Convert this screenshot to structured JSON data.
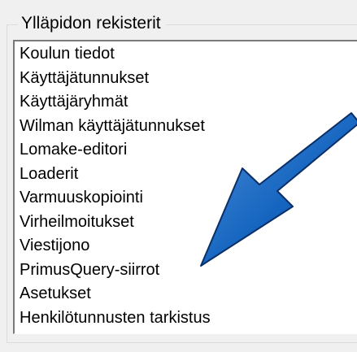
{
  "groupbox": {
    "title": "Ylläpidon rekisterit"
  },
  "list": {
    "items": [
      "Koulun tiedot",
      "Käyttäjätunnukset",
      "Käyttäjäryhmät",
      "Wilman käyttäjätunnukset",
      "Lomake-editori",
      "Loaderit",
      "Varmuuskopiointi",
      "Virheilmoitukset",
      "Viestijono",
      "PrimusQuery-siirrot",
      "Asetukset",
      "Henkilötunnusten tarkistus"
    ]
  },
  "annotation": {
    "arrow_color": "#1565c0",
    "arrow_outline": "#0a2f66",
    "icon": "arrow-annotation-icon"
  }
}
